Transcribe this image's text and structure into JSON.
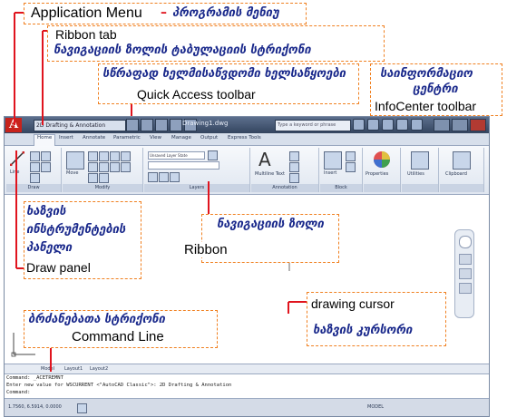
{
  "screenshot": {
    "title_bar": {
      "app_button": "A",
      "workspace": "2D Drafting & Annotation",
      "doc_title": "Drawing1.dwg",
      "search_placeholder": "Type a keyword or phrase"
    },
    "ribbon_tabs": [
      "Home",
      "Insert",
      "Annotate",
      "Parametric",
      "View",
      "Manage",
      "Output",
      "Express Tools"
    ],
    "ribbon_panels": {
      "draw": "Draw",
      "modify": "Modify",
      "layers": "Layers",
      "annotation": "Annotation",
      "block": "Block",
      "properties": "Properties",
      "utilities": "Utilities",
      "clipboard": "Clipboard"
    },
    "ribbon_labels": {
      "line": "Line",
      "move": "Move",
      "multiline_text": "Multiline Text",
      "insert": "Insert",
      "layer_combo": "Unsaved Layer State"
    },
    "layout_tabs": [
      "Model",
      "Layout1",
      "Layout2"
    ],
    "command_lines": [
      "Command: _ACETREMNT",
      "Enter new value for WSCURRENT <\"AutoCAD Classic\">: 2D Drafting & Annotation",
      "Command:"
    ],
    "status_coords": "1.7560, 6.5914, 0.0000",
    "status_model": "MODEL"
  },
  "annotations": {
    "app_menu_en": "Application Menu",
    "app_menu_dash": "–",
    "app_menu_ka": "პროგრამის მენიუ",
    "ribbon_tab_en": "Ribbon tab",
    "ribbon_tab_ka": "ნავიგაციის ზოლის ტაბულაციის სტრიქონი",
    "qat_ka": "სწრაფად ხელმისაწვდომი ხელსაწყოები",
    "qat_en": "Quick Access toolbar",
    "infocenter_ka_1": "საინფორმაციო",
    "infocenter_ka_2": "ცენტრი",
    "infocenter_en": "InfoCenter  toolbar",
    "draw_ka_1": "ხაზვის",
    "draw_ka_2": "ინსტრუმენტების",
    "draw_ka_3": "პანელი",
    "draw_en": "Draw panel",
    "ribbon_ka": "ნავიგაციის ზოლი",
    "ribbon_en": "Ribbon",
    "cursor_en": "drawing cursor",
    "cursor_ka": "ხაზვის კურსორი",
    "cmd_ka": "ბრძანებათა სტრიქონი",
    "cmd_en": "Command Line"
  },
  "colors": {
    "annotation_border": "#f08020",
    "georgian_text": "#1b2a8c",
    "leader_lines": "#e0141e"
  }
}
